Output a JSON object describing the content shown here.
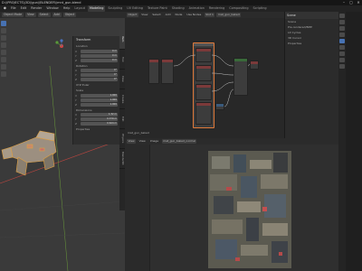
{
  "window": {
    "title": "D:\\\\PROJECTS\\\\3D\\\\gun\\\\BLENDER\\\\mnt_gun.blend",
    "controls": [
      "–",
      "▢",
      "✕"
    ]
  },
  "menubar": {
    "items": [
      "File",
      "Edit",
      "Render",
      "Window",
      "Help"
    ],
    "workspaces": [
      "Layout",
      "Modeling",
      "Sculpting",
      "UV Editing",
      "Texture Paint",
      "Shading",
      "Animation",
      "Rendering",
      "Compositing",
      "Scripting"
    ],
    "active_workspace": "Modeling"
  },
  "viewport": {
    "header": [
      "Object Mode",
      "View",
      "Select",
      "Add",
      "Object"
    ],
    "npanel": {
      "title": "Transform",
      "location_label": "Location",
      "location": [
        "0 m",
        "0 m",
        "0 m"
      ],
      "rotation_label": "Rotation",
      "rotation": [
        "0°",
        "0°",
        "0°"
      ],
      "mode_label": "XYZ Euler",
      "scale_label": "Scale",
      "scale": [
        "1.000",
        "1.000",
        "1.000"
      ],
      "dimensions_label": "Dimensions",
      "dimensions": [
        "1.32 m",
        "0.379 m",
        "0.624 m"
      ],
      "properties_label": "Properties"
    },
    "side_tabs": [
      "Item",
      "Tool",
      "View",
      "Create",
      "Edit",
      "Physics",
      "BlenderKit"
    ]
  },
  "node_editor": {
    "header": [
      "Object",
      "View",
      "Select",
      "Add",
      "Node",
      "Use Nodes",
      "Slot 1",
      "mat_gun_baked"
    ],
    "material_name": "mat_gun_baked"
  },
  "properties": {
    "header": "Scene",
    "render_engine": "Scene",
    "rows": [
      "Scene",
      "Pre-rendered/BMP",
      "Lit Cycles"
    ],
    "sections": [
      "3D Cursor",
      "Properties"
    ]
  },
  "image_editor": {
    "header": [
      "View",
      "View",
      "Image",
      "mat_gun_baked_normal"
    ],
    "image_name": "mat_gun_baked_normal"
  },
  "colors": {
    "accent": "#4772b3",
    "selected_node": "#e07a3a",
    "axis_x": "#b3453f",
    "axis_y": "#6a9a3a"
  }
}
